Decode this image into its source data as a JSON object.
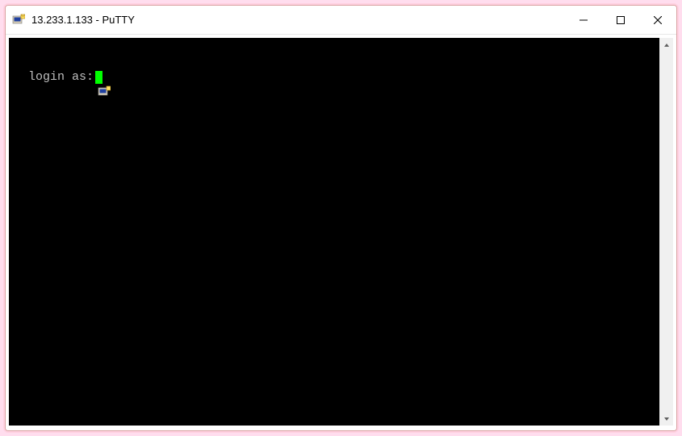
{
  "window": {
    "title": "13.233.1.133 - PuTTY"
  },
  "terminal": {
    "prompt": "login as:",
    "cursor_color": "#00ff00",
    "background": "#000000",
    "foreground": "#bfbfbf"
  },
  "icons": {
    "app": "putty-icon",
    "minimize": "minimize-icon",
    "maximize": "maximize-icon",
    "close": "close-icon",
    "scroll_up": "scroll-up-icon",
    "scroll_down": "scroll-down-icon",
    "sysmenu": "putty-sysmenu-icon"
  }
}
